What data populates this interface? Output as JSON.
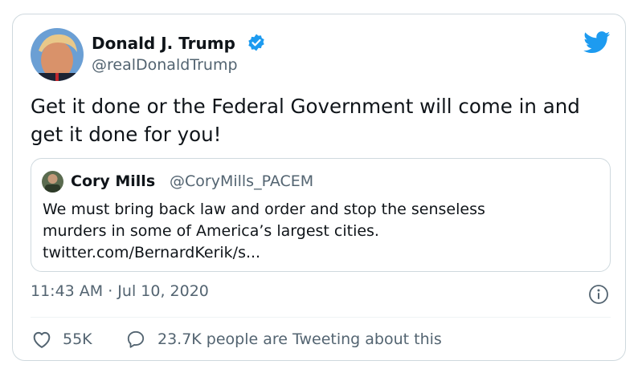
{
  "author": {
    "name": "Donald J. Trump",
    "handle": "@realDonaldTrump",
    "verified": true
  },
  "tweet": {
    "text": "Get it done or the Federal Government will come in and get it done for you!"
  },
  "quoted_tweet": {
    "name": "Cory Mills",
    "handle": "@CoryMills_PACEM",
    "text_line1": "We must bring back law and order and stop the senseless",
    "text_line2": "murders in some of America’s largest cities.",
    "text_line3": "twitter.com/BernardKerik/s..."
  },
  "meta": {
    "timestamp": "11:43 AM · Jul 10, 2020"
  },
  "actions": {
    "likes": "55K",
    "conversation": "23.7K people are Tweeting about this"
  },
  "icons": {
    "logo": "twitter-bird-icon",
    "verified": "verified-badge-icon",
    "info": "info-icon",
    "like": "heart-icon",
    "reply": "speech-bubble-icon"
  },
  "colors": {
    "brand": "#1d9bf0",
    "text": "#0f1419",
    "secondary": "#536471",
    "border": "#cfd9de"
  }
}
